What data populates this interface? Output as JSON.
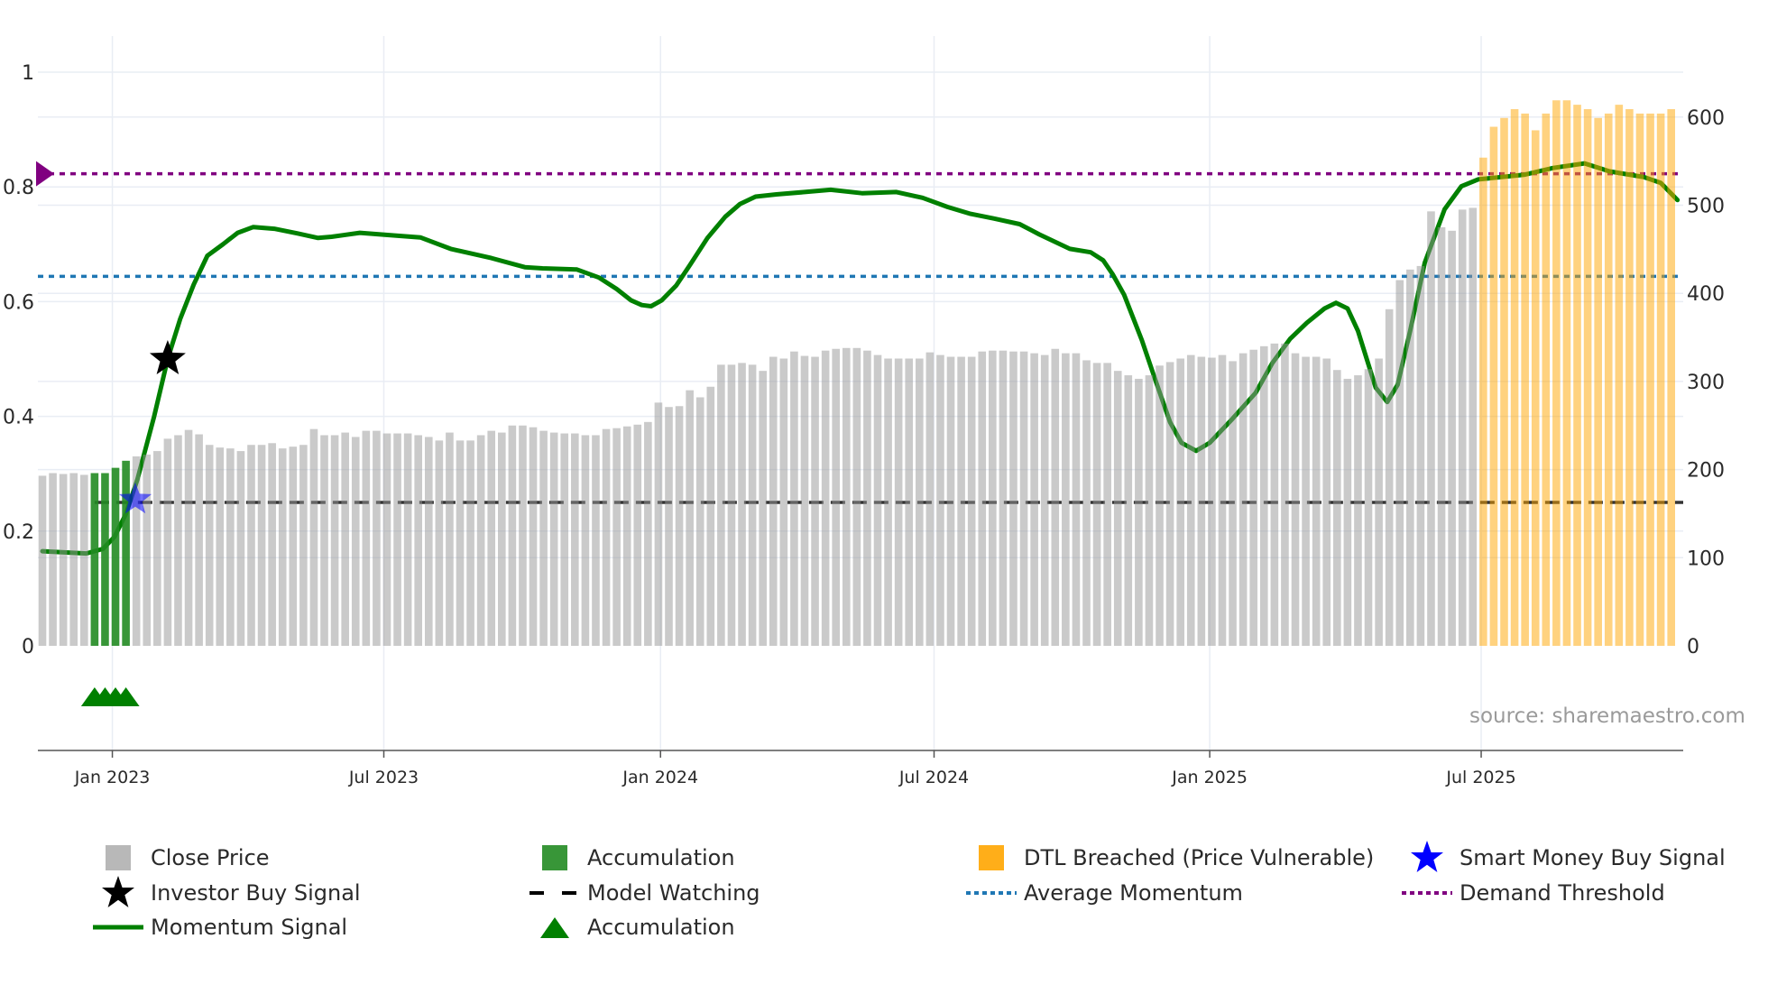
{
  "chart_data": {
    "type": "bar",
    "title": "",
    "x_unit": "week index (weekly bars)",
    "x_ticks": [
      {
        "label": "Jan 2023",
        "x": 6.7
      },
      {
        "label": "Jul 2023",
        "x": 32.7
      },
      {
        "label": "Jan 2024",
        "x": 59.2
      },
      {
        "label": "Jul 2024",
        "x": 85.4
      },
      {
        "label": "Jan 2025",
        "x": 111.8
      },
      {
        "label": "Jul 2025",
        "x": 137.8
      }
    ],
    "y_left": {
      "range": [
        0,
        1
      ],
      "ticks": [
        "0",
        "0.2",
        "0.4",
        "0.6",
        "0.8",
        "1"
      ],
      "tick_values": [
        0,
        0.2,
        0.4,
        0.6,
        0.8,
        1
      ]
    },
    "y_right": {
      "range": [
        0,
        600
      ],
      "ticks": [
        "0",
        "100",
        "200",
        "300",
        "400",
        "500",
        "600"
      ],
      "tick_values": [
        0,
        100,
        200,
        300,
        400,
        500,
        600
      ]
    },
    "close_price": [
      193,
      196,
      195,
      196,
      194,
      196,
      196,
      202,
      210,
      215,
      217,
      221,
      235,
      239,
      245,
      240,
      228,
      225,
      224,
      221,
      228,
      228,
      230,
      224,
      226,
      228,
      246,
      239,
      239,
      242,
      237,
      244,
      244,
      241,
      241,
      241,
      239,
      237,
      233,
      242,
      233,
      233,
      239,
      244,
      242,
      250,
      250,
      248,
      244,
      242,
      241,
      241,
      239,
      239,
      246,
      247,
      249,
      251,
      254,
      276,
      271,
      272,
      290,
      282,
      294,
      319,
      319,
      321,
      319,
      312,
      328,
      326,
      334,
      329,
      328,
      335,
      337,
      338,
      338,
      335,
      330,
      326,
      326,
      326,
      326,
      333,
      330,
      328,
      328,
      328,
      334,
      335,
      335,
      334,
      334,
      332,
      330,
      337,
      332,
      332,
      324,
      321,
      321,
      312,
      307,
      303,
      307,
      318,
      322,
      326,
      330,
      328,
      327,
      330,
      323,
      332,
      336,
      340,
      343,
      343,
      332,
      328,
      328,
      326,
      313,
      303,
      307,
      314,
      326,
      382,
      415,
      427,
      431,
      493,
      475,
      471,
      495,
      497,
      554,
      589,
      599,
      609,
      604,
      585,
      604,
      619,
      619,
      614,
      609,
      599,
      604,
      614,
      609,
      604,
      604,
      604,
      609
    ],
    "accumulation_bars": [
      5,
      6,
      7,
      8
    ],
    "dtl_breached_from": 138,
    "momentum": [
      [
        0,
        0.165
      ],
      [
        4.2,
        0.161
      ],
      [
        5.8,
        0.169
      ],
      [
        6.9,
        0.19
      ],
      [
        8,
        0.23
      ],
      [
        9.1,
        0.29
      ],
      [
        10.7,
        0.4
      ],
      [
        12,
        0.5
      ],
      [
        13.2,
        0.57
      ],
      [
        14.5,
        0.63
      ],
      [
        15.8,
        0.68
      ],
      [
        17.3,
        0.7
      ],
      [
        18.7,
        0.72
      ],
      [
        20.2,
        0.73
      ],
      [
        22.2,
        0.727
      ],
      [
        24.4,
        0.719
      ],
      [
        26.4,
        0.711
      ],
      [
        27.7,
        0.713
      ],
      [
        30.4,
        0.72
      ],
      [
        33.2,
        0.716
      ],
      [
        36.2,
        0.712
      ],
      [
        39.1,
        0.692
      ],
      [
        43,
        0.676
      ],
      [
        46.2,
        0.66
      ],
      [
        47.9,
        0.658
      ],
      [
        51.2,
        0.656
      ],
      [
        53.3,
        0.642
      ],
      [
        55,
        0.622
      ],
      [
        56.4,
        0.602
      ],
      [
        57.4,
        0.594
      ],
      [
        58.3,
        0.592
      ],
      [
        59.3,
        0.602
      ],
      [
        60.7,
        0.628
      ],
      [
        62.1,
        0.666
      ],
      [
        63.7,
        0.711
      ],
      [
        65.4,
        0.748
      ],
      [
        66.8,
        0.77
      ],
      [
        68.3,
        0.783
      ],
      [
        70.3,
        0.787
      ],
      [
        73,
        0.791
      ],
      [
        75.5,
        0.795
      ],
      [
        78.5,
        0.789
      ],
      [
        81.8,
        0.791
      ],
      [
        84.3,
        0.781
      ],
      [
        86.7,
        0.765
      ],
      [
        88.9,
        0.753
      ],
      [
        91.1,
        0.745
      ],
      [
        93.6,
        0.735
      ],
      [
        95.5,
        0.717
      ],
      [
        98.4,
        0.692
      ],
      [
        100.4,
        0.686
      ],
      [
        101.6,
        0.672
      ],
      [
        102.5,
        0.648
      ],
      [
        103.6,
        0.612
      ],
      [
        105.3,
        0.533
      ],
      [
        106.6,
        0.463
      ],
      [
        108,
        0.39
      ],
      [
        109.1,
        0.354
      ],
      [
        110.5,
        0.34
      ],
      [
        111.8,
        0.354
      ],
      [
        114,
        0.396
      ],
      [
        116.2,
        0.441
      ],
      [
        117.8,
        0.493
      ],
      [
        119.5,
        0.535
      ],
      [
        121.1,
        0.563
      ],
      [
        122.8,
        0.588
      ],
      [
        123.9,
        0.598
      ],
      [
        125,
        0.588
      ],
      [
        126,
        0.549
      ],
      [
        127.7,
        0.45
      ],
      [
        128.8,
        0.425
      ],
      [
        129.8,
        0.455
      ],
      [
        131,
        0.549
      ],
      [
        132.4,
        0.668
      ],
      [
        134.3,
        0.761
      ],
      [
        135.9,
        0.801
      ],
      [
        137.5,
        0.813
      ],
      [
        141.9,
        0.821
      ],
      [
        144.7,
        0.833
      ],
      [
        147.7,
        0.841
      ],
      [
        150.1,
        0.827
      ],
      [
        153.4,
        0.817
      ],
      [
        155,
        0.807
      ],
      [
        156.6,
        0.777
      ]
    ],
    "investor_buy_signal": {
      "x": 12,
      "value": 0.5
    },
    "smart_money_buy_signal": {
      "x": 8.9,
      "value": 0.255
    },
    "model_watching": {
      "value": 0.25,
      "from": 5
    },
    "average_momentum": 0.644,
    "demand_threshold": 0.823,
    "accumulation_markers": [
      5,
      6,
      7,
      8
    ],
    "grid": true,
    "legend_placement": "bottom",
    "colors": {
      "close": "#b8b8b8",
      "accumulation": "#228b22",
      "dtl": "#ffa500",
      "momentum": "#008000",
      "avg": "#1f77b4",
      "demand": "#800080",
      "smart": "#0000ff",
      "investor": "#000000"
    }
  },
  "source_note": "source: sharemaestro.com",
  "legend": [
    {
      "label": "Close Price",
      "symbol": "square",
      "color": "#b8b8b8"
    },
    {
      "label": "Accumulation",
      "symbol": "square",
      "color": "#228b22"
    },
    {
      "label": "DTL Breached (Price Vulnerable)",
      "symbol": "square",
      "color": "#ffa500"
    },
    {
      "label": "Smart Money Buy Signal",
      "symbol": "star",
      "color": "#0000ff"
    },
    {
      "label": "Investor Buy Signal",
      "symbol": "star",
      "color": "#000000"
    },
    {
      "label": "Model Watching",
      "symbol": "dash",
      "color": "#000000"
    },
    {
      "label": "Average Momentum",
      "symbol": "dot",
      "color": "#1f77b4"
    },
    {
      "label": "Demand Threshold",
      "symbol": "dot",
      "color": "#800080"
    },
    {
      "label": "Momentum Signal",
      "symbol": "line",
      "color": "#008000"
    },
    {
      "label": "Accumulation",
      "symbol": "triangle",
      "color": "#008000"
    }
  ]
}
